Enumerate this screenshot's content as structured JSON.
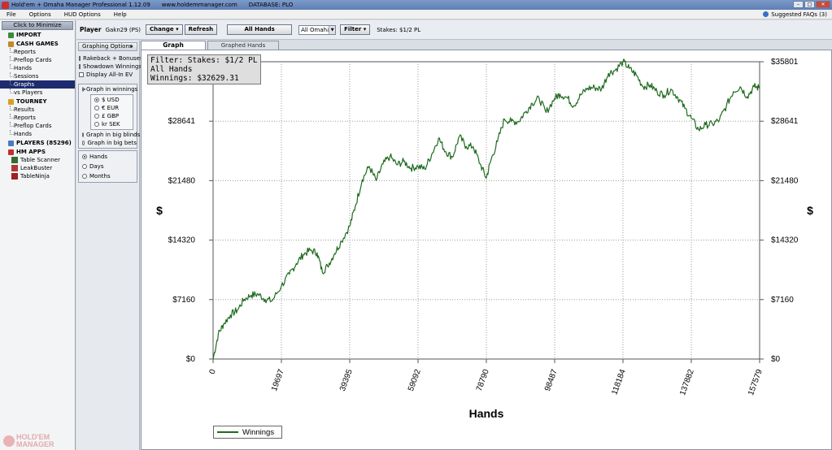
{
  "window": {
    "title": "Hold'em + Omaha Manager Professional 1.12.09",
    "url": "www.holdemmanager.com",
    "database": "DATABASE: PLO"
  },
  "menu": {
    "items": [
      "File",
      "Options",
      "HUD Options",
      "Help"
    ],
    "suggested_faqs": "Suggested FAQs (3)"
  },
  "nav": {
    "minimize": "Click to Minimize",
    "import": "IMPORT",
    "cash_games": "CASH GAMES",
    "cash_items": [
      "Reports",
      "Preflop Cards",
      "Hands",
      "Sessions",
      "Graphs",
      "vs Players"
    ],
    "tourney": "TOURNEY",
    "tourney_items": [
      "Results",
      "Reports",
      "Preflop Cards",
      "Hands"
    ],
    "players": "PLAYERS (85296)",
    "hm_apps": "HM APPS",
    "apps": [
      "Table Scanner",
      "LeakBuster",
      "TableNinja"
    ],
    "brand_line1": "HOLD'EM",
    "brand_line2": "MANAGER"
  },
  "toolbar": {
    "player_label": "Player",
    "player_value": "Gakn29 (PS)",
    "change": "Change",
    "refresh": "Refresh",
    "all_hands": "All Hands",
    "game_select": "All Omaha",
    "filter": "Filter",
    "stakes": "Stakes: $1/2 PL"
  },
  "options": {
    "header": "Graphing Options",
    "collapse": "«",
    "checkboxes": [
      "Rakeback + Bonuses",
      "Showdown Winnings",
      "Display All-In EV"
    ],
    "graph_in_winnings": "Graph in winnings",
    "currencies": [
      "$ USD",
      "€ EUR",
      "£ GBP",
      "kr SEK"
    ],
    "graph_in_big_blinds": "Graph in big blinds",
    "graph_in_big_bets": "Graph in big bets",
    "xaxis_modes": [
      "Hands",
      "Days",
      "Months"
    ]
  },
  "tabs": {
    "graph": "Graph",
    "graphed_hands": "Graphed Hands"
  },
  "filterbox": {
    "line1": "Filter: Stakes: $1/2 PL",
    "line2": "All Hands",
    "line3": "Winnings: $32629.31"
  },
  "chart_data": {
    "type": "line",
    "title": "",
    "xlabel": "Hands",
    "ylabel": "$",
    "xlim": [
      0,
      157579
    ],
    "ylim": [
      0,
      35801
    ],
    "x_ticks": [
      0,
      19697,
      39395,
      59092,
      78790,
      98487,
      118184,
      137882,
      157579
    ],
    "y_ticks": [
      "$0",
      "$7160",
      "$14320",
      "$21480",
      "$28641",
      "$35801"
    ],
    "y_tick_values": [
      0,
      7160,
      14320,
      21480,
      28641,
      35801
    ],
    "grid": true,
    "legend": "bottom-left",
    "color": "#1f6b1f",
    "series": [
      {
        "name": "Winnings",
        "x": [
          0,
          1500,
          3000,
          5000,
          7000,
          9000,
          11000,
          13000,
          15000,
          17000,
          19697,
          22000,
          24000,
          26000,
          28000,
          30000,
          31500,
          33000,
          35000,
          37000,
          39395,
          41000,
          43000,
          45000,
          47000,
          49000,
          51000,
          53000,
          55000,
          57000,
          59092,
          61000,
          63000,
          65000,
          67000,
          69000,
          71000,
          73000,
          75000,
          77000,
          78790,
          80000,
          82000,
          84000,
          86000,
          88000,
          90000,
          92000,
          94000,
          96000,
          98487,
          100000,
          102000,
          104000,
          106000,
          108000,
          110000,
          112000,
          114000,
          116000,
          118184,
          120000,
          122000,
          124000,
          126000,
          128000,
          130000,
          132000,
          134000,
          136000,
          137882,
          140000,
          142000,
          144000,
          146000,
          148000,
          150000,
          152000,
          154000,
          156000,
          157579
        ],
        "y": [
          0,
          3000,
          4200,
          5300,
          5900,
          7200,
          7700,
          7800,
          7200,
          7000,
          8800,
          10200,
          11500,
          12600,
          13100,
          12800,
          10500,
          11200,
          12700,
          14200,
          16000,
          18400,
          21600,
          23200,
          21500,
          23500,
          24400,
          23400,
          23800,
          23000,
          23200,
          22900,
          24600,
          26600,
          25000,
          24300,
          26800,
          25600,
          25600,
          23500,
          21800,
          23800,
          26200,
          28900,
          28600,
          28600,
          29700,
          30800,
          31400,
          29700,
          31400,
          31900,
          31500,
          30500,
          31800,
          32600,
          32700,
          32500,
          34400,
          34800,
          35801,
          35000,
          34200,
          32800,
          33000,
          32200,
          31800,
          32500,
          31500,
          30200,
          29000,
          27600,
          28200,
          28300,
          28800,
          30500,
          32200,
          32800,
          31600,
          32800,
          32629
        ]
      }
    ]
  }
}
